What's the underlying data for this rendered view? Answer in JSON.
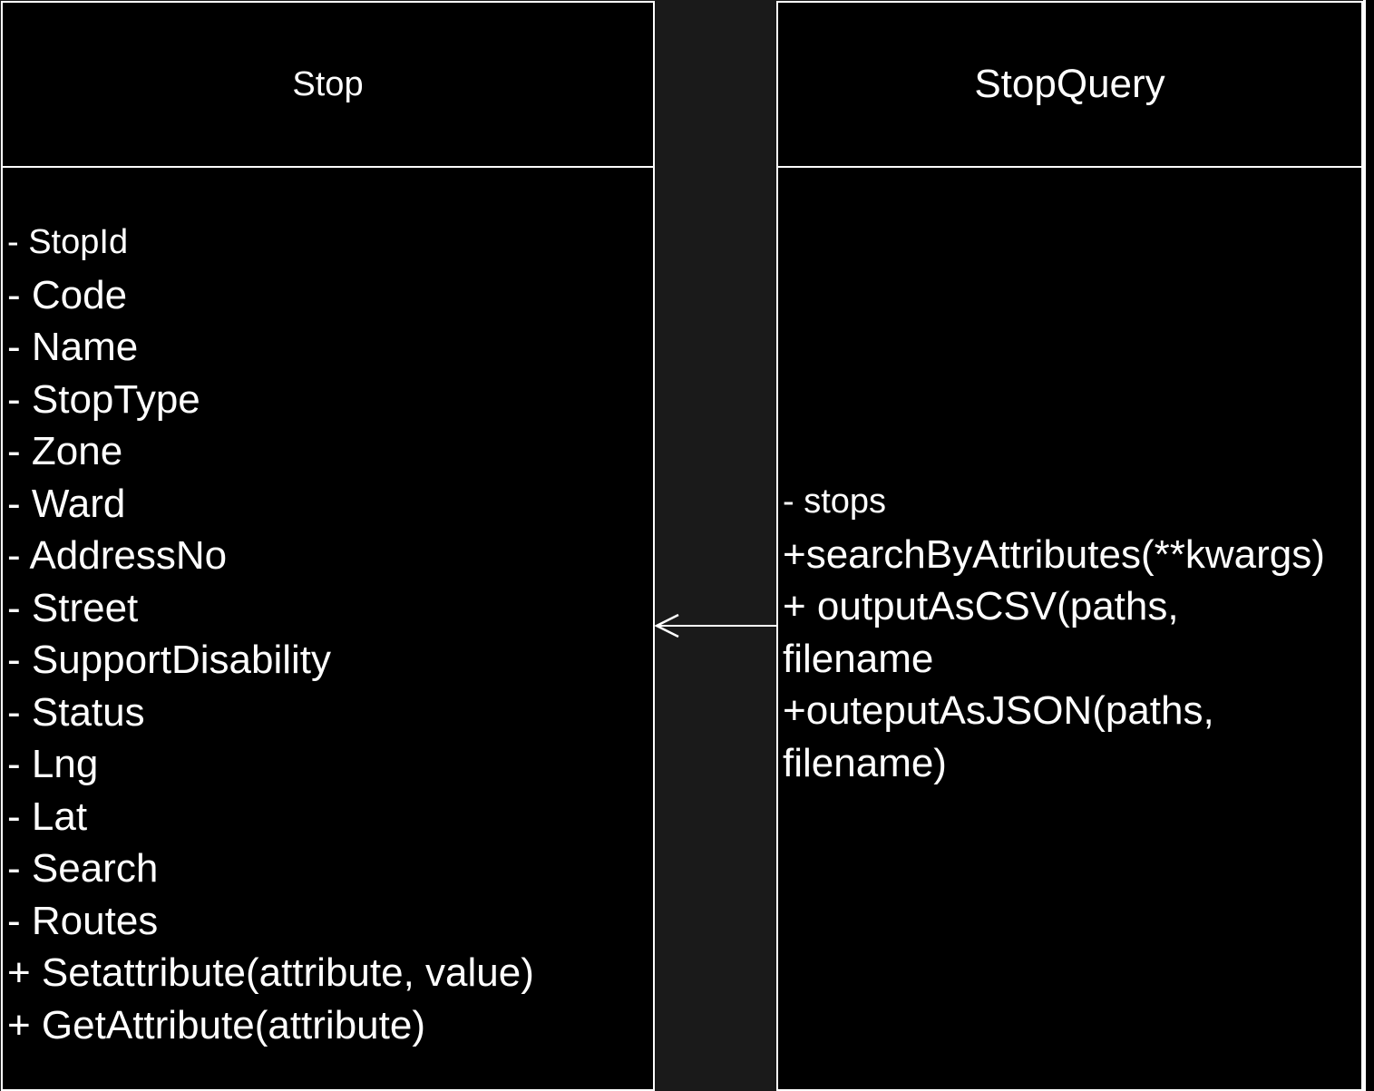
{
  "stop_class": {
    "name": "Stop",
    "members": [
      "- StopId",
      "- Code",
      "- Name",
      "- StopType",
      "- Zone",
      "- Ward",
      "- AddressNo",
      "- Street",
      "- SupportDisability",
      "- Status",
      "- Lng",
      "- Lat",
      "- Search",
      "- Routes",
      "+ Setattribute(attribute, value)",
      "+ GetAttribute(attribute)"
    ]
  },
  "stopquery_class": {
    "name": "StopQuery",
    "members": [
      "- stops",
      "+searchByAttributes(**kwargs)",
      "+ outputAsCSV(paths,",
      "filename",
      "+outeputAsJSON(paths,",
      "filename)"
    ]
  },
  "colors": {
    "background": "#1a1a1a",
    "box_fill": "#000000",
    "stroke": "#ffffff",
    "text": "#ffffff"
  }
}
